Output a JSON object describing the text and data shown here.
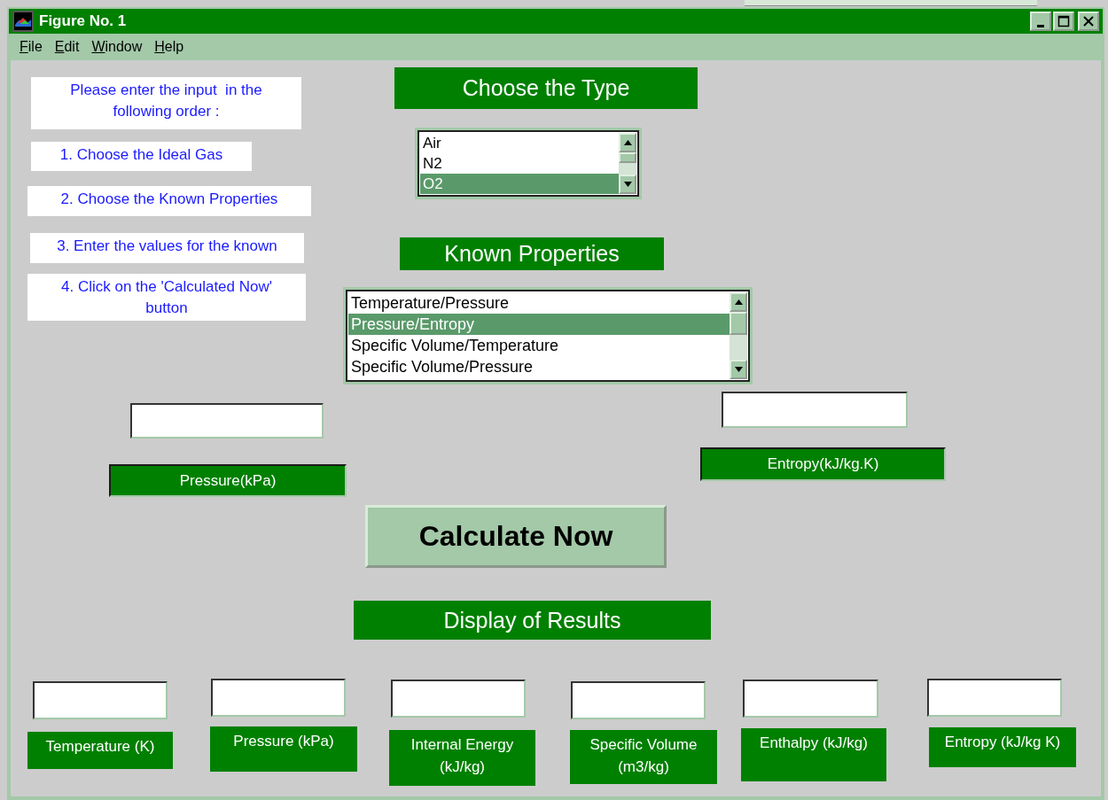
{
  "window": {
    "title": "Figure No. 1"
  },
  "menu": [
    "File",
    "Edit",
    "Window",
    "Help"
  ],
  "instructions": [
    "Please enter the input  in the following order :",
    "1. Choose the Ideal Gas",
    "2. Choose the Known Properties",
    "3. Enter the values for the known",
    "4. Click on the 'Calculated Now' button"
  ],
  "type_header": "Choose the Type",
  "type_list": [
    {
      "label": "Air",
      "selected": false
    },
    {
      "label": "N2",
      "selected": false
    },
    {
      "label": "O2",
      "selected": true
    }
  ],
  "properties_header": "Known Properties",
  "properties_list": [
    {
      "label": "Temperature/Pressure",
      "selected": false
    },
    {
      "label": "Pressure/Entropy",
      "selected": true
    },
    {
      "label": "Specific Volume/Temperature",
      "selected": false
    },
    {
      "label": "Specific Volume/Pressure",
      "selected": false
    }
  ],
  "inputs": [
    {
      "label": "Pressure(kPa)"
    },
    {
      "label": "Entropy(kJ/kg.K)"
    }
  ],
  "calculate_button": "Calculate Now",
  "results_header": "Display of Results",
  "results": [
    {
      "label": "Temperature (K)"
    },
    {
      "label": "Pressure (kPa)"
    },
    {
      "label": "Internal Energy (kJ/kg)"
    },
    {
      "label": "Specific Volume (m3/kg)"
    },
    {
      "label": "Enthalpy (kJ/kg)"
    },
    {
      "label": "Entropy (kJ/kg K)"
    }
  ]
}
